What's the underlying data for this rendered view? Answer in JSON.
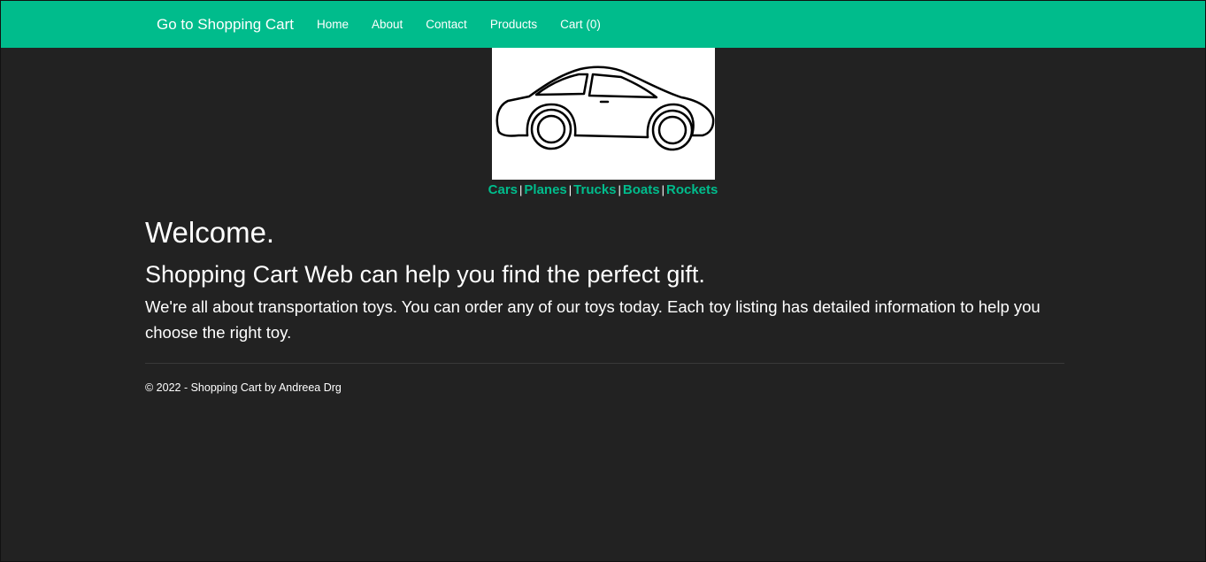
{
  "navbar": {
    "brand": "Go to Shopping Cart",
    "links": [
      "Home",
      "About",
      "Contact",
      "Products",
      "Cart (0)"
    ],
    "background": "#00bc8c"
  },
  "banner": {
    "image": "car-outline-icon",
    "categories": [
      "Cars",
      "Planes",
      "Trucks",
      "Boats",
      "Rockets"
    ],
    "separator": "|"
  },
  "main": {
    "heading": "Welcome.",
    "subheading": "Shopping Cart Web can help you find the perfect gift.",
    "lead": "We're all about transportation toys. You can order any of our toys today. Each toy listing has detailed information to help you choose the right toy."
  },
  "footer": {
    "text": "© 2022 - Shopping Cart by Andreea Drg"
  },
  "colors": {
    "accent": "#00bc8c",
    "background": "#222222",
    "text": "#ffffff"
  }
}
